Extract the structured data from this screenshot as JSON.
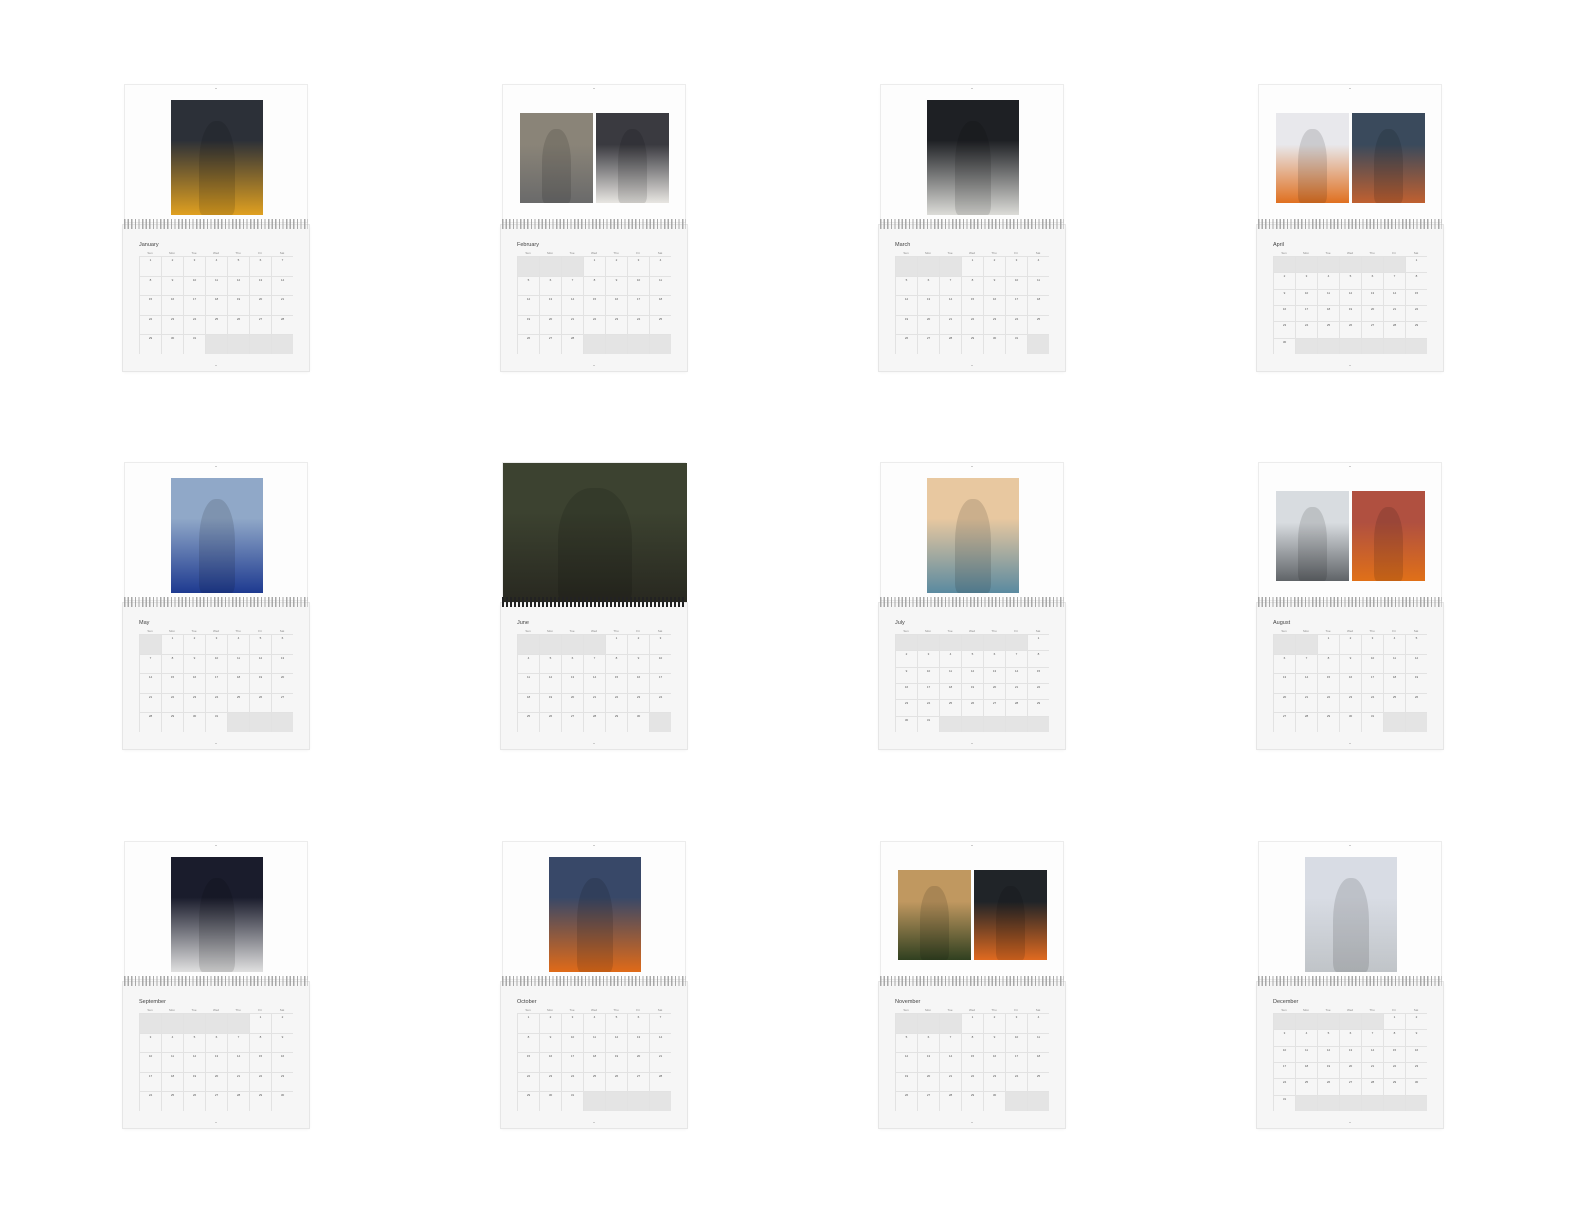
{
  "colors": {
    "background": "#ffffff",
    "page": "#fdfdfd",
    "grid_bg": "#f6f6f6",
    "other_month_cell": "#e4e4e4",
    "holiday_text": "#d04030"
  },
  "weekdays": [
    "Sun",
    "Mon",
    "Tue",
    "Wed",
    "Thu",
    "Fri",
    "Sat"
  ],
  "months": [
    {
      "name": "January",
      "start": 0,
      "days": 31,
      "layout": "single",
      "photos": [
        {
          "desc": "portrait-orange-shirt",
          "top": "#2c3038",
          "bottom": "#e0a020"
        }
      ]
    },
    {
      "name": "February",
      "start": 3,
      "days": 28,
      "layout": "double",
      "photos": [
        {
          "desc": "car-on-track-building",
          "top": "#8a8478",
          "bottom": "#6a6a6a"
        },
        {
          "desc": "driver-in-garage",
          "top": "#3a3a40",
          "bottom": "#e8e6e2"
        }
      ]
    },
    {
      "name": "March",
      "start": 3,
      "days": 31,
      "layout": "single",
      "photos": [
        {
          "desc": "driver-on-white-car",
          "top": "#1e2024",
          "bottom": "#dcdcd8"
        }
      ]
    },
    {
      "name": "April",
      "start": 6,
      "days": 30,
      "layout": "double",
      "photos": [
        {
          "desc": "helmet-with-crew",
          "top": "#e8e8ec",
          "bottom": "#e07020"
        },
        {
          "desc": "pit-garage",
          "top": "#3a4a5c",
          "bottom": "#c06030"
        }
      ]
    },
    {
      "name": "May",
      "start": 1,
      "days": 31,
      "layout": "single",
      "photos": [
        {
          "desc": "blue-hoodie-outdoors",
          "top": "#90a8c8",
          "bottom": "#1e3a90"
        }
      ]
    },
    {
      "name": "June",
      "start": 4,
      "days": 30,
      "layout": "full",
      "photos": [
        {
          "desc": "motion-blur-car-track",
          "top": "#3c4230",
          "bottom": "#282820"
        }
      ]
    },
    {
      "name": "July",
      "start": 6,
      "days": 31,
      "layout": "single",
      "photos": [
        {
          "desc": "lakeside-sunset-portrait",
          "top": "#e8c8a0",
          "bottom": "#5a8aa0"
        }
      ]
    },
    {
      "name": "August",
      "start": 2,
      "days": 31,
      "layout": "double",
      "photos": [
        {
          "desc": "driver-in-cockpit",
          "top": "#d8dce0",
          "bottom": "#606468"
        },
        {
          "desc": "crowd-celebration",
          "top": "#b05040",
          "bottom": "#e07018"
        }
      ]
    },
    {
      "name": "September",
      "start": 5,
      "days": 30,
      "layout": "single",
      "photos": [
        {
          "desc": "seated-on-car-white-outfit",
          "top": "#1a1c2c",
          "bottom": "#e0e0e0"
        }
      ]
    },
    {
      "name": "October",
      "start": 0,
      "days": 31,
      "layout": "single",
      "photos": [
        {
          "desc": "orange-jacket-dusk",
          "top": "#384868",
          "bottom": "#e06a18"
        }
      ]
    },
    {
      "name": "November",
      "start": 3,
      "days": 30,
      "layout": "double",
      "photos": [
        {
          "desc": "blurred-race-cars",
          "top": "#c09860",
          "bottom": "#304020"
        },
        {
          "desc": "orange-cap-close-up",
          "top": "#202428",
          "bottom": "#e06a20"
        }
      ]
    },
    {
      "name": "December",
      "start": 5,
      "days": 31,
      "layout": "single",
      "photos": [
        {
          "desc": "white-shirt-studio",
          "top": "#d8dce4",
          "bottom": "#c0c4c8"
        }
      ]
    }
  ]
}
